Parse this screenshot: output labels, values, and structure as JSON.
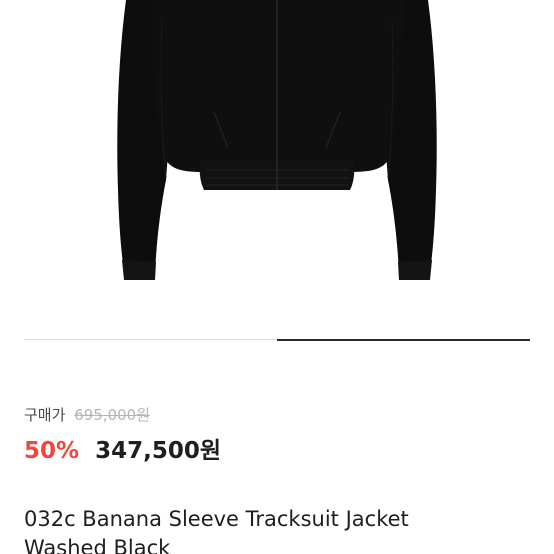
{
  "product": {
    "image_alt": "jacket-image",
    "price_label": "구매가",
    "original_price": "695,000원",
    "discount": "50%",
    "sale_price": "347,500원",
    "title_line1": "032c Banana Sleeve Tracksuit Jacket",
    "title_line2": "Washed Black"
  },
  "carousel": {
    "active_fraction": 0.5
  },
  "colors": {
    "accent": "#f0483e",
    "text": "#1e1e1e",
    "muted": "#b5b5b5",
    "jacket": "#0d0d0e"
  }
}
